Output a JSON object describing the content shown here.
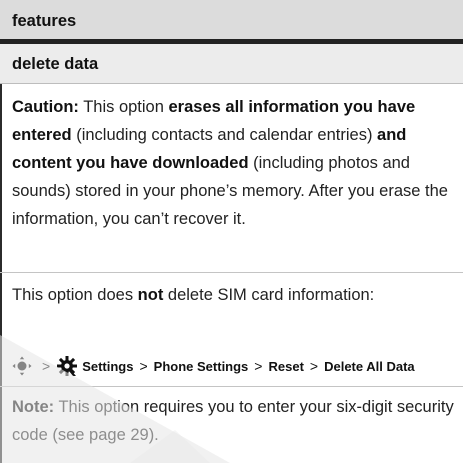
{
  "header": {
    "title": "features"
  },
  "subheader": {
    "title": "delete data"
  },
  "caution": {
    "label": "Caution:",
    "t1": " This option ",
    "b1": "erases all information you have entered",
    "t2": " (including contacts and calendar entries) ",
    "b2": "and content you have downloaded",
    "t3": " (including photos and sounds) stored in your phone’s memory. After you erase the information, you can’t recover it."
  },
  "sim": {
    "t1": "This option does ",
    "b1": "not",
    "t2": " delete SIM card information:"
  },
  "path": {
    "icons": [
      "nav-key-icon",
      "settings-gear-icon"
    ],
    "separator": ">",
    "items": [
      "Settings",
      "Phone Settings",
      "Reset",
      "Delete All Data"
    ]
  },
  "note": {
    "label": "Note:",
    "text": " This option requires you to enter your six-digit security code (see page 29)."
  }
}
